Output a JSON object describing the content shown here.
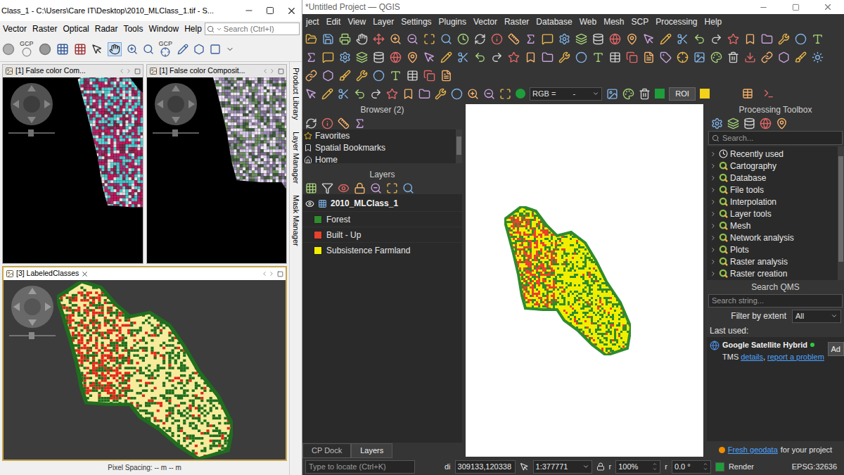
{
  "snap": {
    "title": "Class_1 - C:\\Users\\Care IT\\Desktop\\2010_MLClass_1.tif - S...",
    "menu": [
      "Vector",
      "Raster",
      "Optical",
      "Radar",
      "Tools",
      "Window",
      "Help"
    ],
    "search": {
      "placeholder": "Search (Ctrl+I)"
    },
    "toolbar": {
      "labels": [
        "GCP",
        "GCP"
      ]
    },
    "views": [
      {
        "label": "[1] False color Com...",
        "kind": "photo",
        "selected": false,
        "closable": false
      },
      {
        "label": "[1] False color Composit...",
        "kind": "photo",
        "selected": false,
        "closable": false
      },
      {
        "label": "[3] LabeledClasses",
        "kind": "classes",
        "selected": true,
        "closable": true
      }
    ],
    "side_tabs": [
      "Product Library",
      "Layer Manager",
      "Mask Manager"
    ],
    "status": "Pixel Spacing: -- m -- m"
  },
  "qgis": {
    "title": "*Untitled Project — QGIS",
    "menu": [
      "ject",
      "Edit",
      "View",
      "Layer",
      "Settings",
      "Plugins",
      "Vector",
      "Raster",
      "Database",
      "Web",
      "Mesh",
      "SCP",
      "Processing",
      "Help"
    ],
    "scp_toolbar": {
      "band_set_label": "RGB =",
      "band_set_value": "-",
      "roi": "ROI"
    },
    "browser": {
      "title": "Browser (2)",
      "items": [
        "Favorites",
        "Spatial Bookmarks",
        "Home"
      ]
    },
    "layers": {
      "title": "Layers",
      "group": {
        "name": "2010_MLClass_1",
        "visible": true
      },
      "classes": [
        {
          "name": "Forest",
          "color": "#2e8b2e"
        },
        {
          "name": "Built - Up",
          "color": "#e8412c"
        },
        {
          "name": "Subsistence Farmland",
          "color": "#f2ee00"
        }
      ]
    },
    "toolbox": {
      "title": "Processing Toolbox",
      "placeholder": "Search...",
      "items": [
        {
          "label": "Recently used",
          "kind": "history",
          "expanded": false
        },
        {
          "label": "Cartography",
          "kind": "group",
          "expanded": false
        },
        {
          "label": "Database",
          "kind": "group",
          "expanded": false
        },
        {
          "label": "File tools",
          "kind": "group",
          "expanded": false
        },
        {
          "label": "Interpolation",
          "kind": "group",
          "expanded": false
        },
        {
          "label": "Layer tools",
          "kind": "group",
          "expanded": false
        },
        {
          "label": "Mesh",
          "kind": "group",
          "expanded": false
        },
        {
          "label": "Network analysis",
          "kind": "group",
          "expanded": false
        },
        {
          "label": "Plots",
          "kind": "group",
          "expanded": false
        },
        {
          "label": "Raster analysis",
          "kind": "group",
          "expanded": false
        },
        {
          "label": "Raster creation",
          "kind": "group",
          "expanded": false
        }
      ]
    },
    "qms": {
      "title": "Search QMS",
      "placeholder": "Search string...",
      "filter_label": "Filter by extent",
      "filter_value": "All",
      "last_used": "Last used:",
      "services": [
        {
          "name": "Google Satellite Hybrid",
          "type": "TMS",
          "links": [
            {
              "label": "details",
              "kind": "link"
            },
            {
              "label": ",",
              "kind": "text"
            },
            {
              "label": "report a problem",
              "kind": "link"
            }
          ],
          "status_color": "#2ecc40",
          "add": "Ad"
        }
      ]
    },
    "fresh": {
      "link": "Fresh geodata",
      "text": "for your project"
    },
    "dock_tabs": [
      {
        "label": "CP Dock",
        "selected": false
      },
      {
        "label": "Layers",
        "selected": true
      }
    ],
    "status": {
      "locate_placeholder": "Type to locate (Ctrl+K)",
      "coord_label": "di",
      "coordinate": "309133,120338",
      "scale": "1:377771",
      "magnifier_label": "r",
      "magnifier": "100%",
      "rotation_label": "r",
      "rotation": "0.0 °",
      "render_label": "Render",
      "render": true,
      "crs": "EPSG:32636"
    }
  }
}
